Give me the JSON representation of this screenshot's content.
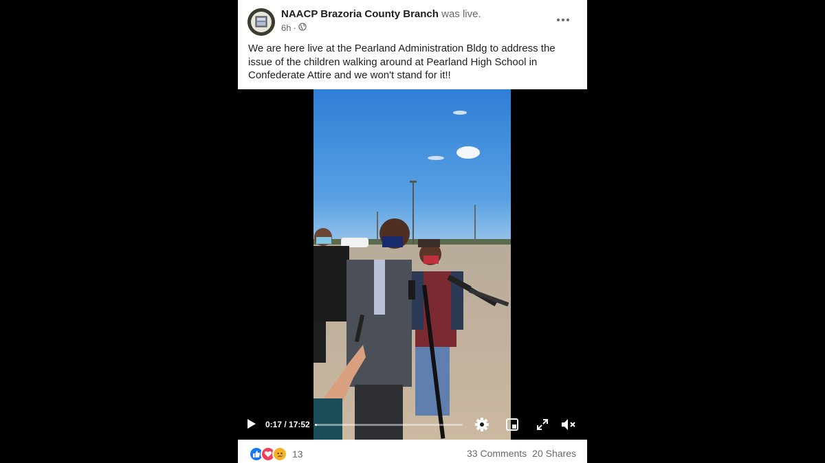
{
  "post": {
    "author": "NAACP Brazoria County Branch",
    "author_suffix": "was live.",
    "time": "6h",
    "separator": "·",
    "privacy_icon": "globe-icon",
    "more_icon": "more-horizontal-icon",
    "text": "We are here live at the Pearland Administration Bldg to address the issue of the children walking around at Pearland High School in Confederate Attire and we won't stand for it!!"
  },
  "video": {
    "current_time": "0:17",
    "duration": "17:52",
    "time_display": "0:17 / 17:52",
    "progress_fraction": 0.016,
    "controls": [
      "play-icon",
      "settings-gear-icon",
      "picture-in-picture-icon",
      "fullscreen-icon",
      "volume-muted-icon"
    ]
  },
  "footer": {
    "reaction_icons": [
      "like-icon",
      "love-icon",
      "sad-icon"
    ],
    "reaction_count": "13",
    "comments": "33 Comments",
    "shares": "20 Shares"
  },
  "colors": {
    "background": "#000000",
    "card": "#ffffff",
    "text_primary": "#1c1e21",
    "text_secondary": "#65676b",
    "like_blue": "#1877f2",
    "love_red": "#f33e58",
    "sad_yellow": "#f7b125",
    "sky": "#3a86d8",
    "pavement": "#c9b8a2"
  }
}
